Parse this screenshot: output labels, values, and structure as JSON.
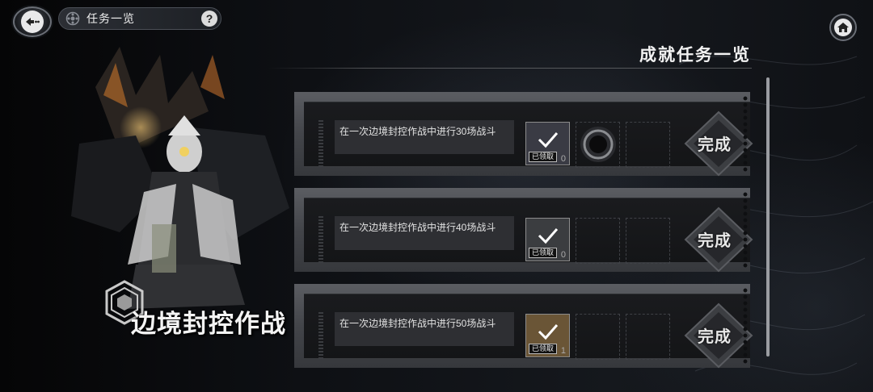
{
  "header": {
    "title": "任务一览",
    "help_label": "?"
  },
  "event": {
    "name": "边境封控作战"
  },
  "panel": {
    "title": "成就任务一览"
  },
  "tasks": [
    {
      "description": "在一次边境封控作战中进行30场战斗",
      "status_label": "已领取",
      "reward_count": "0",
      "complete_label": "完成",
      "reward_color": "#3a3b44",
      "extra_reward": "dark-ring-icon"
    },
    {
      "description": "在一次边境封控作战中进行40场战斗",
      "status_label": "已领取",
      "reward_count": "0",
      "complete_label": "完成",
      "reward_color": "#3b3d40"
    },
    {
      "description": "在一次边境封控作战中进行50场战斗",
      "status_label": "已领取",
      "reward_count": "1",
      "complete_label": "完成",
      "reward_color": "#6a5536"
    }
  ],
  "colors": {
    "accent": "#f2f2f2",
    "card": "#43454a",
    "background": "#0e1014"
  }
}
